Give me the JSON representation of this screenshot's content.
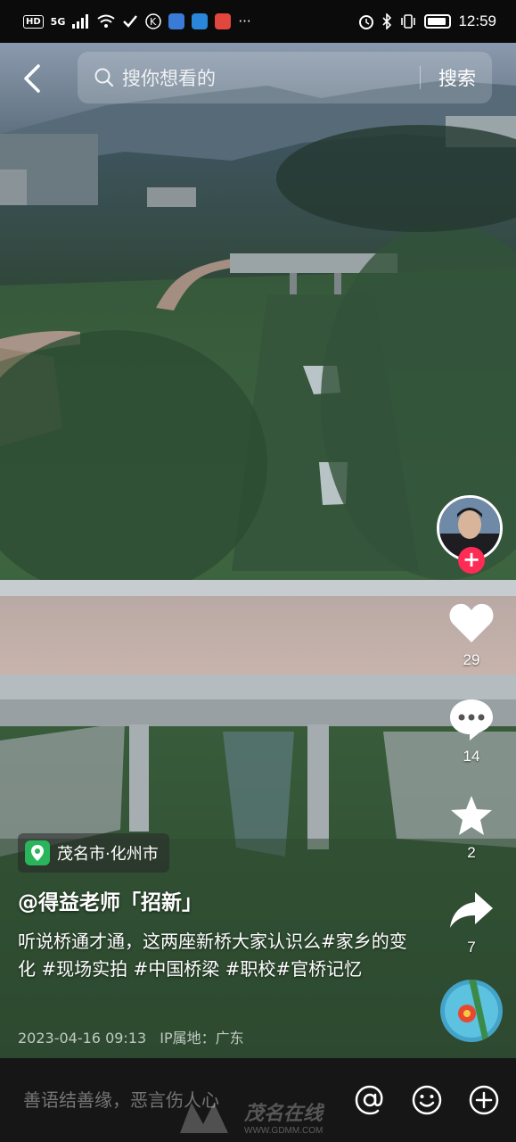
{
  "status_bar": {
    "network_badge": "HD",
    "signal_label": "5G",
    "time": "12:59"
  },
  "search": {
    "placeholder": "搜你想看的",
    "submit_label": "搜索"
  },
  "actions": {
    "likes": "29",
    "comments": "14",
    "favorites": "2",
    "shares": "7",
    "follow_symbol": "+"
  },
  "post": {
    "location": "茂名市·化州市",
    "author": "@得益老师「招新」",
    "description": "听说桥通才通，这两座新桥大家认识么#家乡的变化 #现场实拍 #中国桥梁 #职校#官桥记忆",
    "date": "2023-04-16 09:13",
    "ip_location": "IP属地：广东"
  },
  "comment_bar": {
    "placeholder": "善语结善缘，恶言伤人心"
  },
  "watermark": {
    "text": "茂名在线",
    "url": "WWW.GDMM.COM"
  },
  "colors": {
    "follow": "#fe2c55",
    "location_icon": "#2bb55a"
  }
}
